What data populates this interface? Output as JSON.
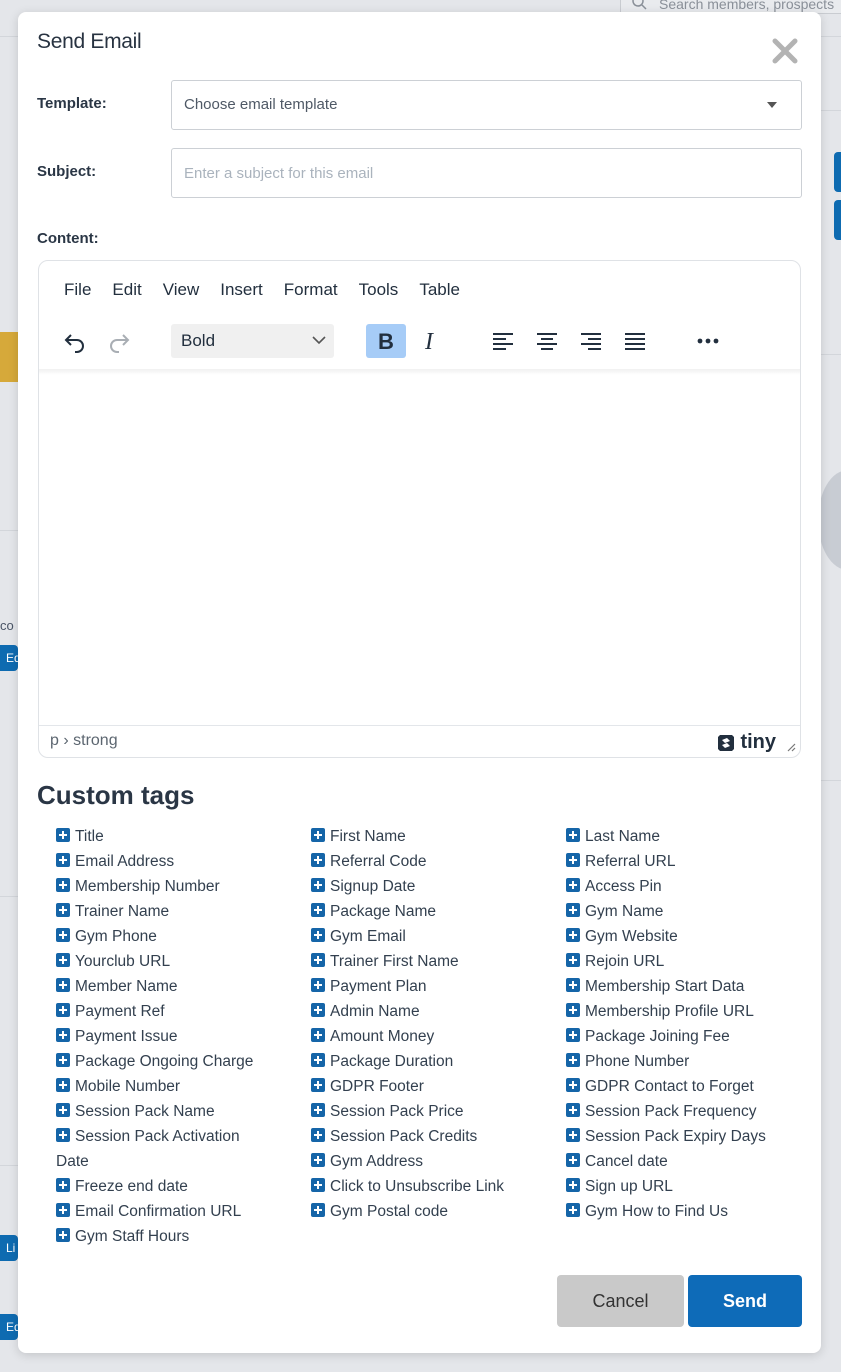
{
  "background": {
    "search_placeholder": "Search members, prospects",
    "left_text": "co",
    "left_btn_1": "Ed",
    "left_btn_2": "Li",
    "left_btn_3": "Ed"
  },
  "modal": {
    "title": "Send Email",
    "template_label": "Template:",
    "template_value": "Choose email template",
    "subject_label": "Subject:",
    "subject_placeholder": "Enter a subject for this email",
    "content_label": "Content:"
  },
  "editor": {
    "menu": [
      "File",
      "Edit",
      "View",
      "Insert",
      "Format",
      "Tools",
      "Table"
    ],
    "format_select": "Bold",
    "path": "p › strong",
    "logo": "tiny",
    "bold_active": true
  },
  "custom_tags": {
    "heading": "Custom tags",
    "columns": [
      [
        "Title",
        "Email Address",
        "Membership Number",
        "Trainer Name",
        "Gym Phone",
        "Yourclub URL",
        "Member Name",
        "Payment Ref",
        "Payment Issue",
        "Package Ongoing Charge",
        "Mobile Number",
        "Session Pack Name",
        "Session Pack Activation Date",
        "Freeze end date",
        "Email Confirmation URL",
        "Gym Staff Hours"
      ],
      [
        "First Name",
        "Referral Code",
        "Signup Date",
        "Package Name",
        "Gym Email",
        "Trainer First Name",
        "Payment Plan",
        "Admin Name",
        "Amount Money",
        "Package Duration",
        "GDPR Footer",
        "Session Pack Price",
        "Session Pack Credits",
        "Gym Address",
        "Click to Unsubscribe Link",
        "Gym Postal code"
      ],
      [
        "Last Name",
        "Referral URL",
        "Access Pin",
        "Gym Name",
        "Gym Website",
        "Rejoin URL",
        "Membership Start Data",
        "Membership Profile URL",
        "Package Joining Fee",
        "Phone Number",
        "GDPR Contact to Forget",
        "Session Pack Frequency",
        "Session Pack Expiry Days",
        "Cancel date",
        "Sign up URL",
        "Gym How to Find Us"
      ]
    ]
  },
  "buttons": {
    "cancel": "Cancel",
    "send": "Send"
  },
  "colors": {
    "primary": "#0e6bb8",
    "tag_icon": "#1565a8",
    "bold_active_bg": "#a6ccf7",
    "cancel_bg": "#c9c9c9",
    "accent_yellow": "#d6a93a"
  }
}
